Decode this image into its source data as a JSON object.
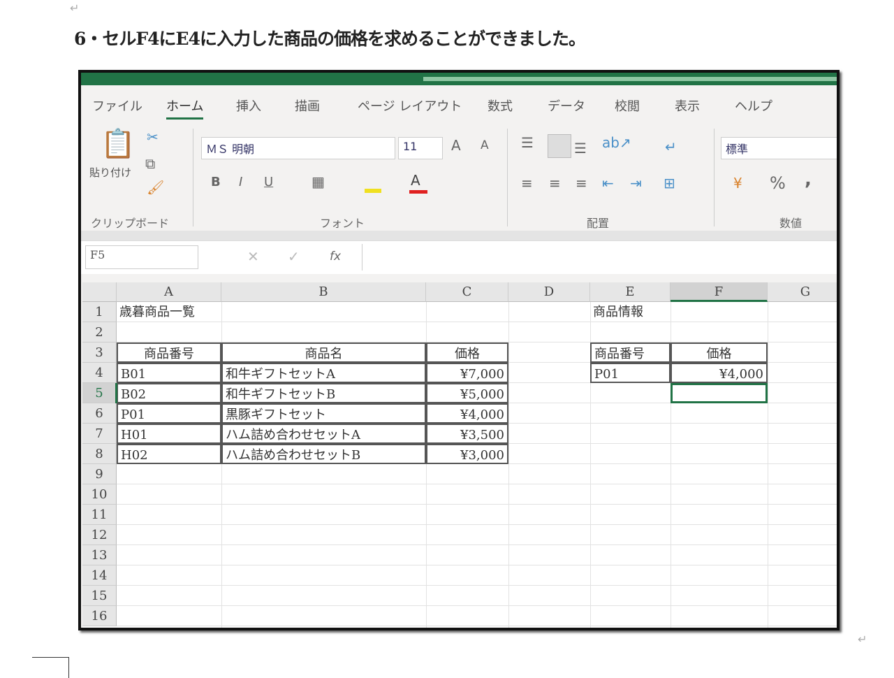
{
  "document": {
    "instruction": "6・セルF4にE4に入力した商品の価格を求めることができました。",
    "paragraph_mark": "↵"
  },
  "excel": {
    "tabs": [
      "ファイル",
      "ホーム",
      "挿入",
      "描画",
      "ページ レイアウト",
      "数式",
      "データ",
      "校閲",
      "表示",
      "ヘルプ"
    ],
    "ribbon": {
      "paste": "貼り付け",
      "clipboard": "クリップボード",
      "font_name": "ＭＳ 明朝",
      "font_size": "11",
      "bold": "B",
      "italic": "I",
      "underline": "U",
      "font_group": "フォント",
      "align_group": "配置",
      "number_format": "標準",
      "percent": "%",
      "comma": ",",
      "number_group": "数値"
    },
    "name_box": "F5",
    "formula": "",
    "fx": "fx",
    "columns": [
      "A",
      "B",
      "C",
      "D",
      "E",
      "F",
      "G"
    ],
    "rows": [
      "1",
      "2",
      "3",
      "4",
      "5",
      "6",
      "7",
      "8",
      "9",
      "10",
      "11",
      "12",
      "13",
      "14",
      "15",
      "16"
    ],
    "a1": "歳暮商品一覧",
    "e1": "商品情報",
    "headers": {
      "code": "商品番号",
      "name": "商品名",
      "price": "価格"
    },
    "products": [
      {
        "code": "B01",
        "name": "和牛ギフトセットA",
        "price": "¥7,000"
      },
      {
        "code": "B02",
        "name": "和牛ギフトセットB",
        "price": "¥5,000"
      },
      {
        "code": "P01",
        "name": "黒豚ギフトセット",
        "price": "¥4,000"
      },
      {
        "code": "H01",
        "name": "ハム詰め合わせセットA",
        "price": "¥3,500"
      },
      {
        "code": "H02",
        "name": "ハム詰め合わせセットB",
        "price": "¥3,000"
      }
    ],
    "lookup": {
      "code_header": "商品番号",
      "price_header": "価格",
      "code": "P01",
      "price": "¥4,000"
    }
  },
  "colors": {
    "excel_green": "#217346"
  }
}
